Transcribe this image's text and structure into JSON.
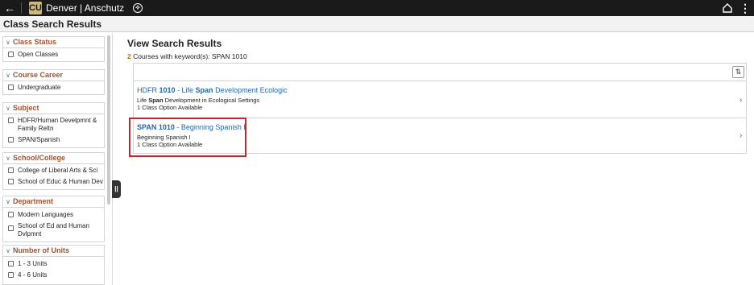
{
  "topbar": {
    "back_icon": "arrow-left-icon",
    "logo_text": "CU",
    "brand": "Denver | Anschutz",
    "help_icon": "compass-icon",
    "home_icon": "home-icon",
    "menu_icon": "vertical-dots-icon"
  },
  "page_title": "Class Search Results",
  "filters": [
    {
      "title": "Class Status",
      "options": [
        "Open Classes"
      ]
    },
    {
      "title": "Course Career",
      "options": [
        "Undergraduate"
      ]
    },
    {
      "title": "Subject",
      "options": [
        "HDFR/Human Develpmnt & Family Reltn",
        "SPAN/Spanish"
      ]
    },
    {
      "title": "School/College",
      "options": [
        "College of Liberal Arts & Sci",
        "School of Educ & Human Dev"
      ]
    },
    {
      "title": "Department",
      "options": [
        "Modern Languages",
        "School of Ed and Human Dvlpmnt"
      ]
    },
    {
      "title": "Number of Units",
      "options": [
        "1 - 3 Units",
        "4 - 6 Units"
      ]
    }
  ],
  "results": {
    "title": "View Search Results",
    "count": "2",
    "count_suffix": "Courses with keyword(s): SPAN 1010",
    "sort_icon": "sort-icon",
    "courses": [
      {
        "code_pre": "HDFR ",
        "code_num": "1010",
        "title_pre": " - Life ",
        "title_bold": "Span",
        "title_post": " Development Ecologic",
        "desc_pre": "Life ",
        "desc_bold": "Span",
        "desc_post": " Development in Ecological Settings",
        "options": "1 Class Option Available"
      },
      {
        "code_pre": "SPAN",
        "code_num": " 1010",
        "title_pre": " - Beginning Spanish I",
        "title_bold": "",
        "title_post": "",
        "desc_pre": "Beginning Spanish I",
        "desc_bold": "",
        "desc_post": "",
        "options": "1 Class Option Available"
      }
    ]
  },
  "colors": {
    "accent": "#1f66b3",
    "filter_header": "#a0522d",
    "highlight": "#c0272d",
    "topbar": "#1a1a1a"
  }
}
